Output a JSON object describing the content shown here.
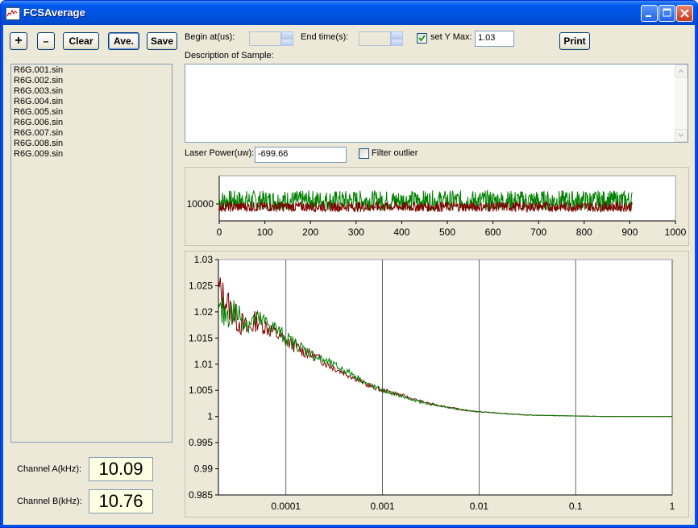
{
  "window": {
    "title": "FCSAverage"
  },
  "toolbar": {
    "add_label": "+",
    "remove_label": "–",
    "clear_label": "Clear",
    "ave_label": "Ave.",
    "save_label": "Save",
    "begin_label": "Begin at(us):",
    "begin_value": "",
    "end_label": "End time(s):",
    "end_value": "",
    "set_ymax_label": "set Y Max:",
    "set_ymax_checked": true,
    "ymax_value": "1.03",
    "print_label": "Print"
  },
  "description": {
    "label": "Description of Sample:",
    "value": ""
  },
  "laser": {
    "label": "Laser Power(uw):",
    "value": "-699.66",
    "filter_label": "Filter outlier",
    "filter_checked": false
  },
  "files": [
    "R6G.001.sin",
    "R6G.002.sin",
    "R6G.003.sin",
    "R6G.004.sin",
    "R6G.005.sin",
    "R6G.006.sin",
    "R6G.007.sin",
    "R6G.008.sin",
    "R6G.009.sin"
  ],
  "channels": {
    "a_label": "Channel A(kHz):",
    "a_value": "10.09",
    "b_label": "Channel B(kHz):",
    "b_value": "10.76"
  },
  "colors": {
    "series_a": "#008000",
    "series_b": "#800000",
    "plot_bg": "#ffffff",
    "panel_bg": "#ece9d8"
  },
  "chart_data": [
    {
      "type": "line",
      "title": "",
      "xlabel": "",
      "ylabel": "",
      "xlim": [
        0,
        1000
      ],
      "x_ticks": [
        "0",
        "100",
        "200",
        "300",
        "400",
        "500",
        "600",
        "700",
        "800",
        "900",
        "1000"
      ],
      "y_ticks": [
        "10000"
      ],
      "y_tick_values": [
        10000
      ],
      "ylim": [
        8500,
        12500
      ],
      "series": [
        {
          "color": "#008000",
          "x_range": [
            0,
            905
          ],
          "baseline": 10300,
          "amplitude": 900
        },
        {
          "color": "#800000",
          "x_range": [
            0,
            905
          ],
          "baseline": 9750,
          "amplitude": 450
        }
      ]
    },
    {
      "type": "line",
      "title": "",
      "xlabel": "",
      "ylabel": "",
      "x_scale": "log",
      "xlim": [
        2e-05,
        1
      ],
      "ylim": [
        0.985,
        1.03
      ],
      "x_ticks": [
        "0.0001",
        "0.001",
        "0.01",
        "0.1",
        "1"
      ],
      "x_tick_values": [
        0.0001,
        0.001,
        0.01,
        0.1,
        1
      ],
      "y_ticks": [
        "1.03",
        "1.025",
        "1.02",
        "1.015",
        "1.01",
        "1.005",
        "1",
        "0.995",
        "0.99",
        "0.985"
      ],
      "y_tick_values": [
        1.03,
        1.025,
        1.02,
        1.015,
        1.01,
        1.005,
        1,
        0.995,
        0.99,
        0.985
      ],
      "grid": "vertical",
      "series": [
        {
          "color": "#800000",
          "x": [
            2e-05,
            3e-05,
            4e-05,
            5e-05,
            7e-05,
            0.0001,
            0.00015,
            0.0002,
            0.0003,
            0.0005,
            0.0007,
            0.001,
            0.0015,
            0.002,
            0.003,
            0.005,
            0.007,
            0.01,
            0.02,
            0.03,
            0.05,
            0.1,
            0.2,
            0.5,
            1
          ],
          "y": [
            1.0245,
            1.019,
            1.0165,
            1.0185,
            1.0165,
            1.0145,
            1.0125,
            1.0115,
            1.0095,
            1.0075,
            1.006,
            1.005,
            1.0042,
            1.0034,
            1.0025,
            1.0017,
            1.0012,
            1.0009,
            1.0005,
            1.0003,
            1.0002,
            1.0001,
            1.0,
            1.0,
            1.0
          ]
        },
        {
          "color": "#008000",
          "x": [
            2e-05,
            3e-05,
            4e-05,
            5e-05,
            7e-05,
            0.0001,
            0.00015,
            0.0002,
            0.0003,
            0.0005,
            0.0007,
            0.001,
            0.0015,
            0.002,
            0.003,
            0.005,
            0.007,
            0.01,
            0.02,
            0.03,
            0.05,
            0.1,
            0.2,
            0.5,
            1
          ],
          "y": [
            1.0195,
            1.02,
            1.018,
            1.0185,
            1.0175,
            1.015,
            1.013,
            1.0115,
            1.01,
            1.008,
            1.0062,
            1.005,
            1.004,
            1.0032,
            1.0024,
            1.0017,
            1.0012,
            1.0009,
            1.0005,
            1.0003,
            1.0002,
            1.0001,
            1.0,
            1.0,
            1.0
          ]
        }
      ]
    }
  ]
}
